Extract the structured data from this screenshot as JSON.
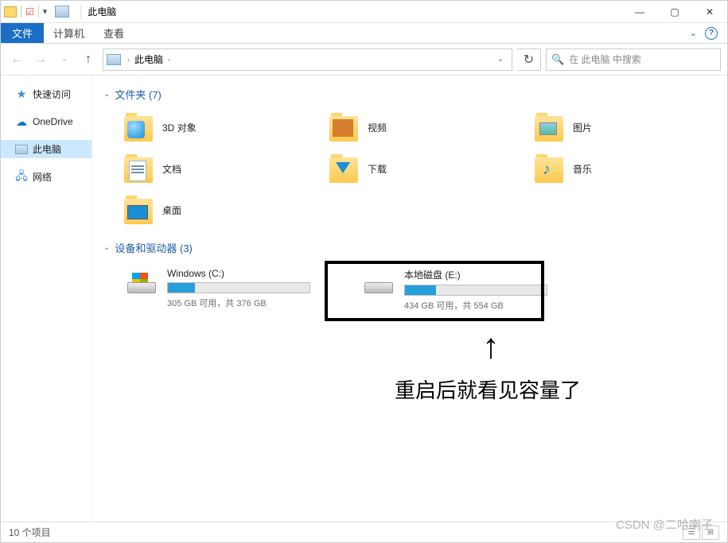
{
  "title": "此电脑",
  "ribbon": {
    "file": "文件",
    "computer": "计算机",
    "view": "查看"
  },
  "breadcrumb": {
    "root": "此电脑"
  },
  "search": {
    "placeholder": "在 此电脑 中搜索"
  },
  "sidebar": {
    "quick": "快速访问",
    "onedrive": "OneDrive",
    "thispc": "此电脑",
    "network": "网络"
  },
  "groups": {
    "folders": "文件夹 (7)",
    "drives": "设备和驱动器 (3)"
  },
  "folders": {
    "objects3d": "3D 对象",
    "videos": "视频",
    "pictures": "图片",
    "documents": "文档",
    "downloads": "下载",
    "music": "音乐",
    "desktop": "桌面"
  },
  "drives": {
    "c": {
      "name": "Windows (C:)",
      "stat": "305 GB 可用，共 376 GB",
      "fill_pct": 19
    },
    "e": {
      "name": "本地磁盘 (E:)",
      "stat": "434 GB 可用，共 554 GB",
      "fill_pct": 22
    }
  },
  "annotation": {
    "text": "重启后就看见容量了"
  },
  "status": {
    "items": "10 个项目"
  },
  "watermark": "CSDN @二哈喇子"
}
